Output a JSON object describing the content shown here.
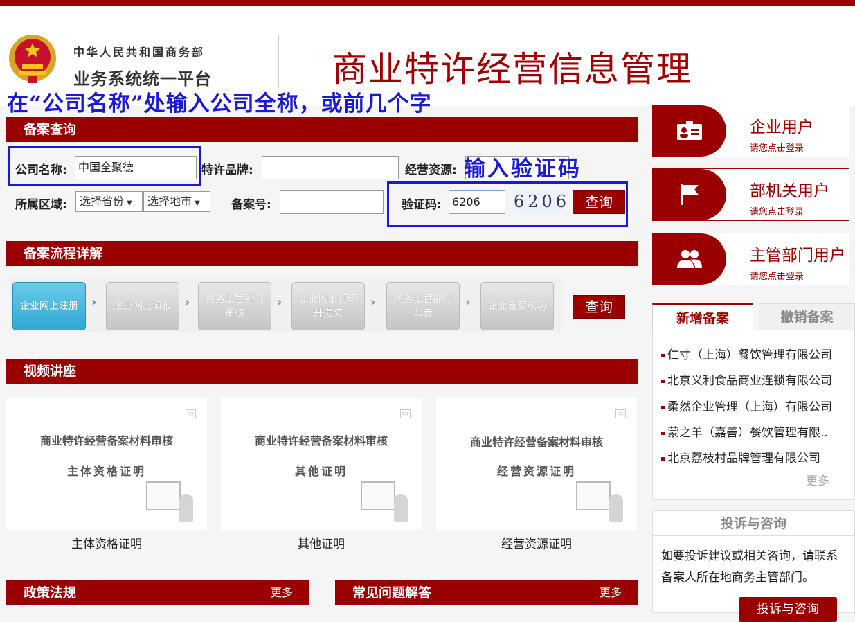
{
  "header": {
    "org_line1": "中华人民共和国商务部",
    "org_line2": "业务系统统一平台",
    "title": "商业特许经营信息管理"
  },
  "annotations": {
    "company_hint": "在“公司名称”处输入公司全称，或前几个字",
    "captcha_hint": "输入验证码"
  },
  "search": {
    "section_title": "备案查询",
    "company_label": "公司名称:",
    "company_value": "中国全聚德",
    "brand_label": "特许品牌:",
    "brand_value": "",
    "resource_label": "经营资源:",
    "resource_value": "",
    "region_label": "所属区域:",
    "province_select": "选择省份",
    "city_select": "选择地市",
    "record_no_label": "备案号:",
    "record_no_value": "",
    "captcha_label": "验证码:",
    "captcha_value": "6206",
    "captcha_image_text": "6206",
    "query_button": "查询"
  },
  "process": {
    "section_title": "备案流程详解",
    "steps": [
      "企业网上注册",
      "企业网上填报",
      "商务主管部门审核",
      "企业网上打印并提交",
      "商务主管部门公告",
      "企业备案成功"
    ],
    "query_button": "查询"
  },
  "videos": {
    "section_title": "视频讲座",
    "items": [
      {
        "title": "商业特许经营备案材料审核",
        "subtitle": "主体资格证明",
        "caption": "主体资格证明"
      },
      {
        "title": "商业特许经营备案材料审核",
        "subtitle": "其他证明",
        "caption": "其他证明"
      },
      {
        "title": "商业特许经营备案材料审核",
        "subtitle": "经营资源证明",
        "caption": "经营资源证明"
      }
    ]
  },
  "bottom": {
    "policy_title": "政策法规",
    "policy_more": "更多",
    "faq_title": "常见问题解答",
    "faq_more": "更多"
  },
  "users": [
    {
      "title": "企业用户",
      "sub": "请您点击登录",
      "icon": "id-card-icon"
    },
    {
      "title": "部机关用户",
      "sub": "请您点击登录",
      "icon": "flag-icon"
    },
    {
      "title": "主管部门用户",
      "sub": "请您点击登录",
      "icon": "users-icon"
    }
  ],
  "records": {
    "tab_new": "新增备案",
    "tab_revoked": "撤销备案",
    "items": [
      "仁寸（上海）餐饮管理有限公司",
      "北京义利食品商业连锁有限公司",
      "柔然企业管理（上海）有限公司",
      "蒙之羊（嘉善）餐饮管理有限..",
      "北京荔枝村品牌管理有限公司"
    ],
    "more": "更多"
  },
  "complaint": {
    "title": "投诉与咨询",
    "body": "如要投诉建议或相关咨询，请联系备案人所在地商务主管部门。",
    "button": "投诉与咨询"
  },
  "colors": {
    "brand_red": "#9b0000",
    "annotation_blue": "#1a1ad6",
    "step_active": "#2ea8d4"
  }
}
